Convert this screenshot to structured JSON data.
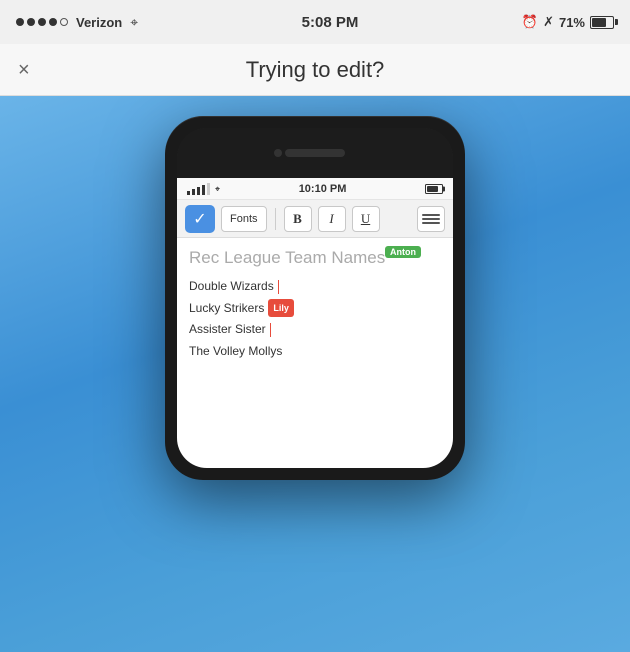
{
  "statusBar": {
    "carrier": "Verizon",
    "time": "5:08 PM",
    "battery": "71%"
  },
  "header": {
    "title": "Trying to edit?",
    "closeLabel": "×"
  },
  "phone": {
    "statusBar": {
      "time": "10:10 PM"
    },
    "toolbar": {
      "checkmark": "✓",
      "fontsLabel": "Fonts",
      "boldLabel": "B",
      "italicLabel": "I",
      "underlineLabel": "U"
    },
    "content": {
      "title": "Rec League Team Names",
      "titleCursor": "Anton",
      "lines": [
        {
          "text": "Double Wizards",
          "cursor": true,
          "cursorType": "bar"
        },
        {
          "text": "Lucky Strikers",
          "cursor": true,
          "cursorType": "lily"
        },
        {
          "text": "Assister Sister",
          "cursor": true,
          "cursorType": "red"
        },
        {
          "text": "The Volley Mollys",
          "cursor": false
        }
      ]
    }
  }
}
